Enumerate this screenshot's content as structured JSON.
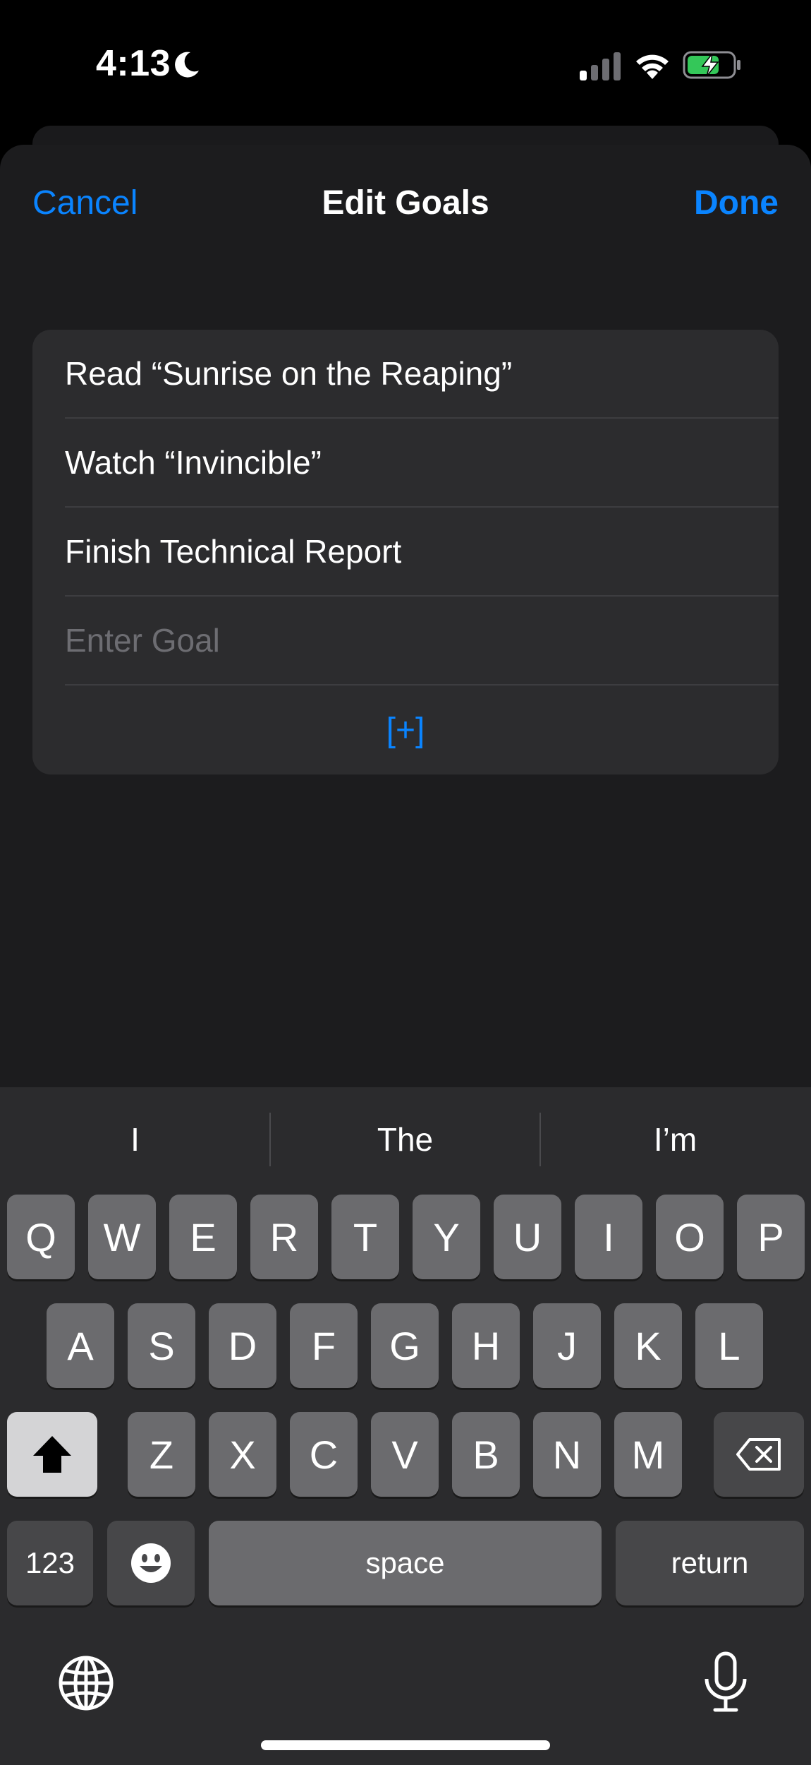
{
  "status": {
    "time": "4:13"
  },
  "nav": {
    "cancel_label": "Cancel",
    "title": "Edit Goals",
    "done_label": "Done"
  },
  "goals": {
    "items": [
      "Read “Sunrise on the Reaping”",
      "Watch “Invincible”",
      "Finish Technical Report"
    ],
    "input_placeholder": "Enter Goal",
    "add_label": "[+]"
  },
  "keyboard": {
    "predictions": [
      "I",
      "The",
      "I’m"
    ],
    "row1": [
      "Q",
      "W",
      "E",
      "R",
      "T",
      "Y",
      "U",
      "I",
      "O",
      "P"
    ],
    "row2": [
      "A",
      "S",
      "D",
      "F",
      "G",
      "H",
      "J",
      "K",
      "L"
    ],
    "row3": [
      "Z",
      "X",
      "C",
      "V",
      "B",
      "N",
      "M"
    ],
    "numbers_label": "123",
    "space_label": "space",
    "return_label": "return",
    "icons": [
      "shift-icon",
      "backspace-icon",
      "emoji-icon",
      "globe-icon",
      "microphone-icon"
    ]
  },
  "colors": {
    "accent": "#0a84ff",
    "sheet_bg": "#1c1c1e",
    "card_bg": "#2c2c2e",
    "battery_charge": "#34c759"
  }
}
